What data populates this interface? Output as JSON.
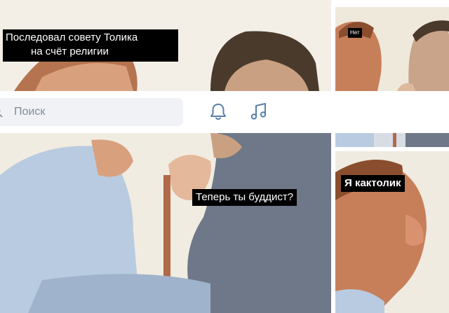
{
  "panels": {
    "top_left_caption_line1": "Последовал совету Толика",
    "top_left_caption_line2": "на счёт религии",
    "top_right_caption": "Нет",
    "middle_caption": "Теперь ты буддист?",
    "bottom_right_caption": "Я кактолик"
  },
  "search": {
    "placeholder": "Поиск"
  },
  "icons": {
    "search": "search-icon",
    "notifications": "bell-icon",
    "music": "music-note-icon"
  },
  "colors": {
    "search_field_bg": "#f0f2f5",
    "placeholder": "#818c99",
    "icon": "#5a7fa8"
  }
}
